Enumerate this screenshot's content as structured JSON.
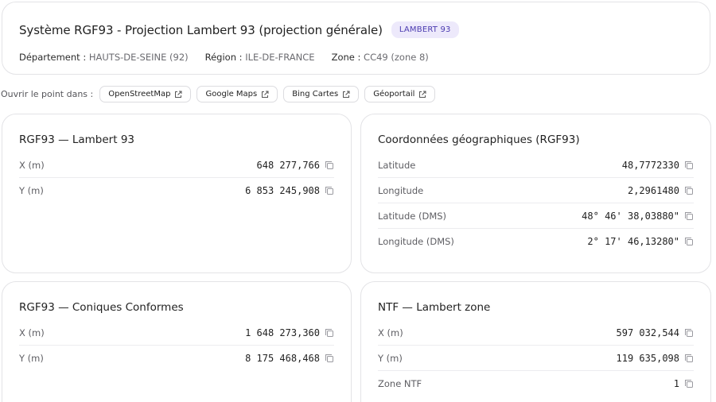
{
  "header": {
    "title": "Système RGF93 - Projection Lambert 93 (projection générale)",
    "badge": "LAMBERT 93",
    "meta": [
      {
        "label": "Département :",
        "value": "HAUTS-DE-SEINE (92)"
      },
      {
        "label": "Région :",
        "value": "ILE-DE-FRANCE"
      },
      {
        "label": "Zone :",
        "value": "CC49 (zone 8)"
      }
    ]
  },
  "open_in": {
    "label": "Ouvrir le point dans :",
    "links": [
      "OpenStreetMap",
      "Google Maps",
      "Bing Cartes",
      "Géoportail"
    ]
  },
  "cards": {
    "lambert93": {
      "title": "RGF93 — Lambert 93",
      "rows": [
        {
          "label": "X (m)",
          "value": "648 277,766"
        },
        {
          "label": "Y (m)",
          "value": "6 853 245,908"
        }
      ]
    },
    "geographic": {
      "title": "Coordonnées géographiques (RGF93)",
      "rows": [
        {
          "label": "Latitude",
          "value": "48,7772330"
        },
        {
          "label": "Longitude",
          "value": "2,2961480"
        },
        {
          "label": "Latitude (DMS)",
          "value": "48° 46' 38,03880\""
        },
        {
          "label": "Longitude (DMS)",
          "value": "2° 17' 46,13280\""
        }
      ]
    },
    "conic": {
      "title": "RGF93 — Coniques Conformes",
      "rows": [
        {
          "label": "X (m)",
          "value": "1 648 273,360"
        },
        {
          "label": "Y (m)",
          "value": "8 175 468,468"
        }
      ]
    },
    "ntf": {
      "title": "NTF — Lambert zone",
      "rows": [
        {
          "label": "X (m)",
          "value": "597 032,544"
        },
        {
          "label": "Y (m)",
          "value": "119 635,098"
        },
        {
          "label": "Zone NTF",
          "value": "1"
        }
      ]
    }
  },
  "colors": {
    "badge_bg": "#ede9fb",
    "badge_text": "#4b3bb0",
    "border": "#e3e3e6"
  },
  "icons": {
    "external": "external-link-icon",
    "copy": "copy-icon"
  }
}
